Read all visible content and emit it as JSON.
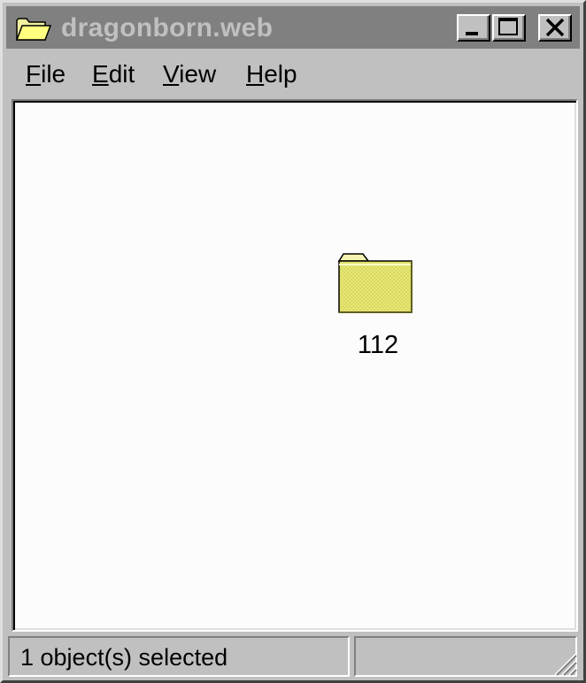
{
  "window": {
    "title": "dragonborn.web",
    "title_icon": "folder-open-icon",
    "controls": {
      "minimize": "minimize-icon",
      "maximize": "maximize-icon",
      "close": "close-icon"
    }
  },
  "menu": {
    "items": [
      {
        "accel": "F",
        "rest": "ile"
      },
      {
        "accel": "E",
        "rest": "dit"
      },
      {
        "accel": "V",
        "rest": "iew"
      },
      {
        "accel": "H",
        "rest": "elp"
      }
    ]
  },
  "content": {
    "items": [
      {
        "label": "112",
        "icon": "folder-icon"
      }
    ]
  },
  "status": {
    "text": "1 object(s) selected",
    "secondary": ""
  },
  "colors": {
    "titlebar_inactive": "#808080",
    "title_text_inactive": "#c0c0c0",
    "window_face": "#c0c0c0",
    "content_bg": "#fcfcfc",
    "folder_yellow": "#e8e878"
  }
}
